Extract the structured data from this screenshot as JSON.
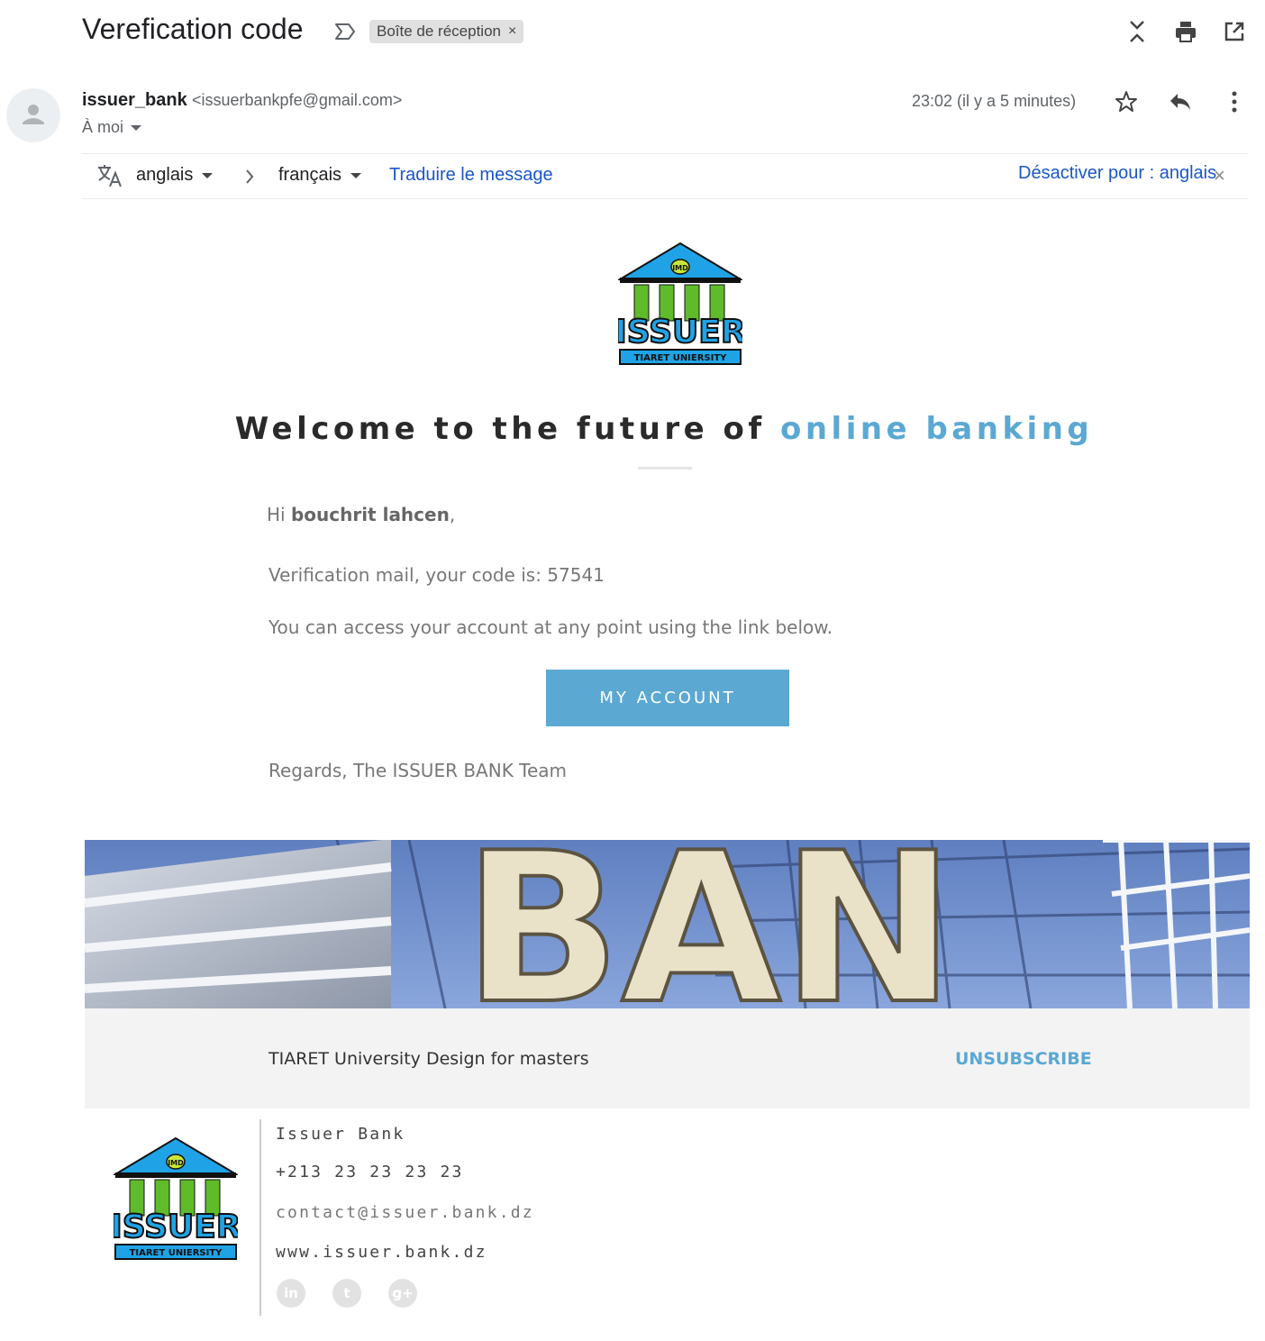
{
  "header": {
    "subject": "Verefication code",
    "label": "Boîte de réception",
    "label_remove": "×"
  },
  "sender": {
    "name": "issuer_bank",
    "email": "<issuerbankpfe@gmail.com>",
    "recipient": "À moi",
    "timestamp": "23:02 (il y a 5 minutes)"
  },
  "translate": {
    "source_lang": "anglais",
    "target_lang": "français",
    "translate_link": "Traduire le message",
    "disable_link": "Désactiver pour : anglais",
    "close": "×"
  },
  "email": {
    "logo_text": "ISSUER",
    "logo_subtext": "TIARET   UNIERSITY",
    "logo_badge": "IMD",
    "welcome_prefix": "Welcome to the future of ",
    "welcome_accent": "online banking",
    "greeting_prefix": "Hi ",
    "greeting_name": "bouchrit lahcen",
    "greeting_suffix": ",",
    "code_line": "Verification mail, your code is: 57541",
    "access_line": "You can access your account at any point using the link below.",
    "button_label": "MY ACCOUNT",
    "regards": "Regards, The ISSUER BANK Team",
    "banner_letters": "BAN"
  },
  "footer": {
    "text": "TIARET University Design for masters",
    "unsubscribe": "UNSUBSCRIBE"
  },
  "signature": {
    "name": "Issuer Bank",
    "phone": "+213 23 23 23 23",
    "email": "contact@issuer.bank.dz",
    "website": "www.issuer.bank.dz",
    "social": [
      "in",
      "t",
      "g+"
    ]
  },
  "colors": {
    "accent": "#5ba8d3",
    "link": "#1a56c8",
    "logo_blue": "#1fa3e6",
    "logo_green": "#5fbb2a"
  },
  "icons": [
    "label-important-icon",
    "expand-collapse-icon",
    "print-icon",
    "open-in-new-icon",
    "star-icon",
    "reply-icon",
    "more-vert-icon",
    "translate-icon",
    "chevron-right-icon",
    "close-icon",
    "linkedin-icon",
    "twitter-icon",
    "googleplus-icon"
  ]
}
